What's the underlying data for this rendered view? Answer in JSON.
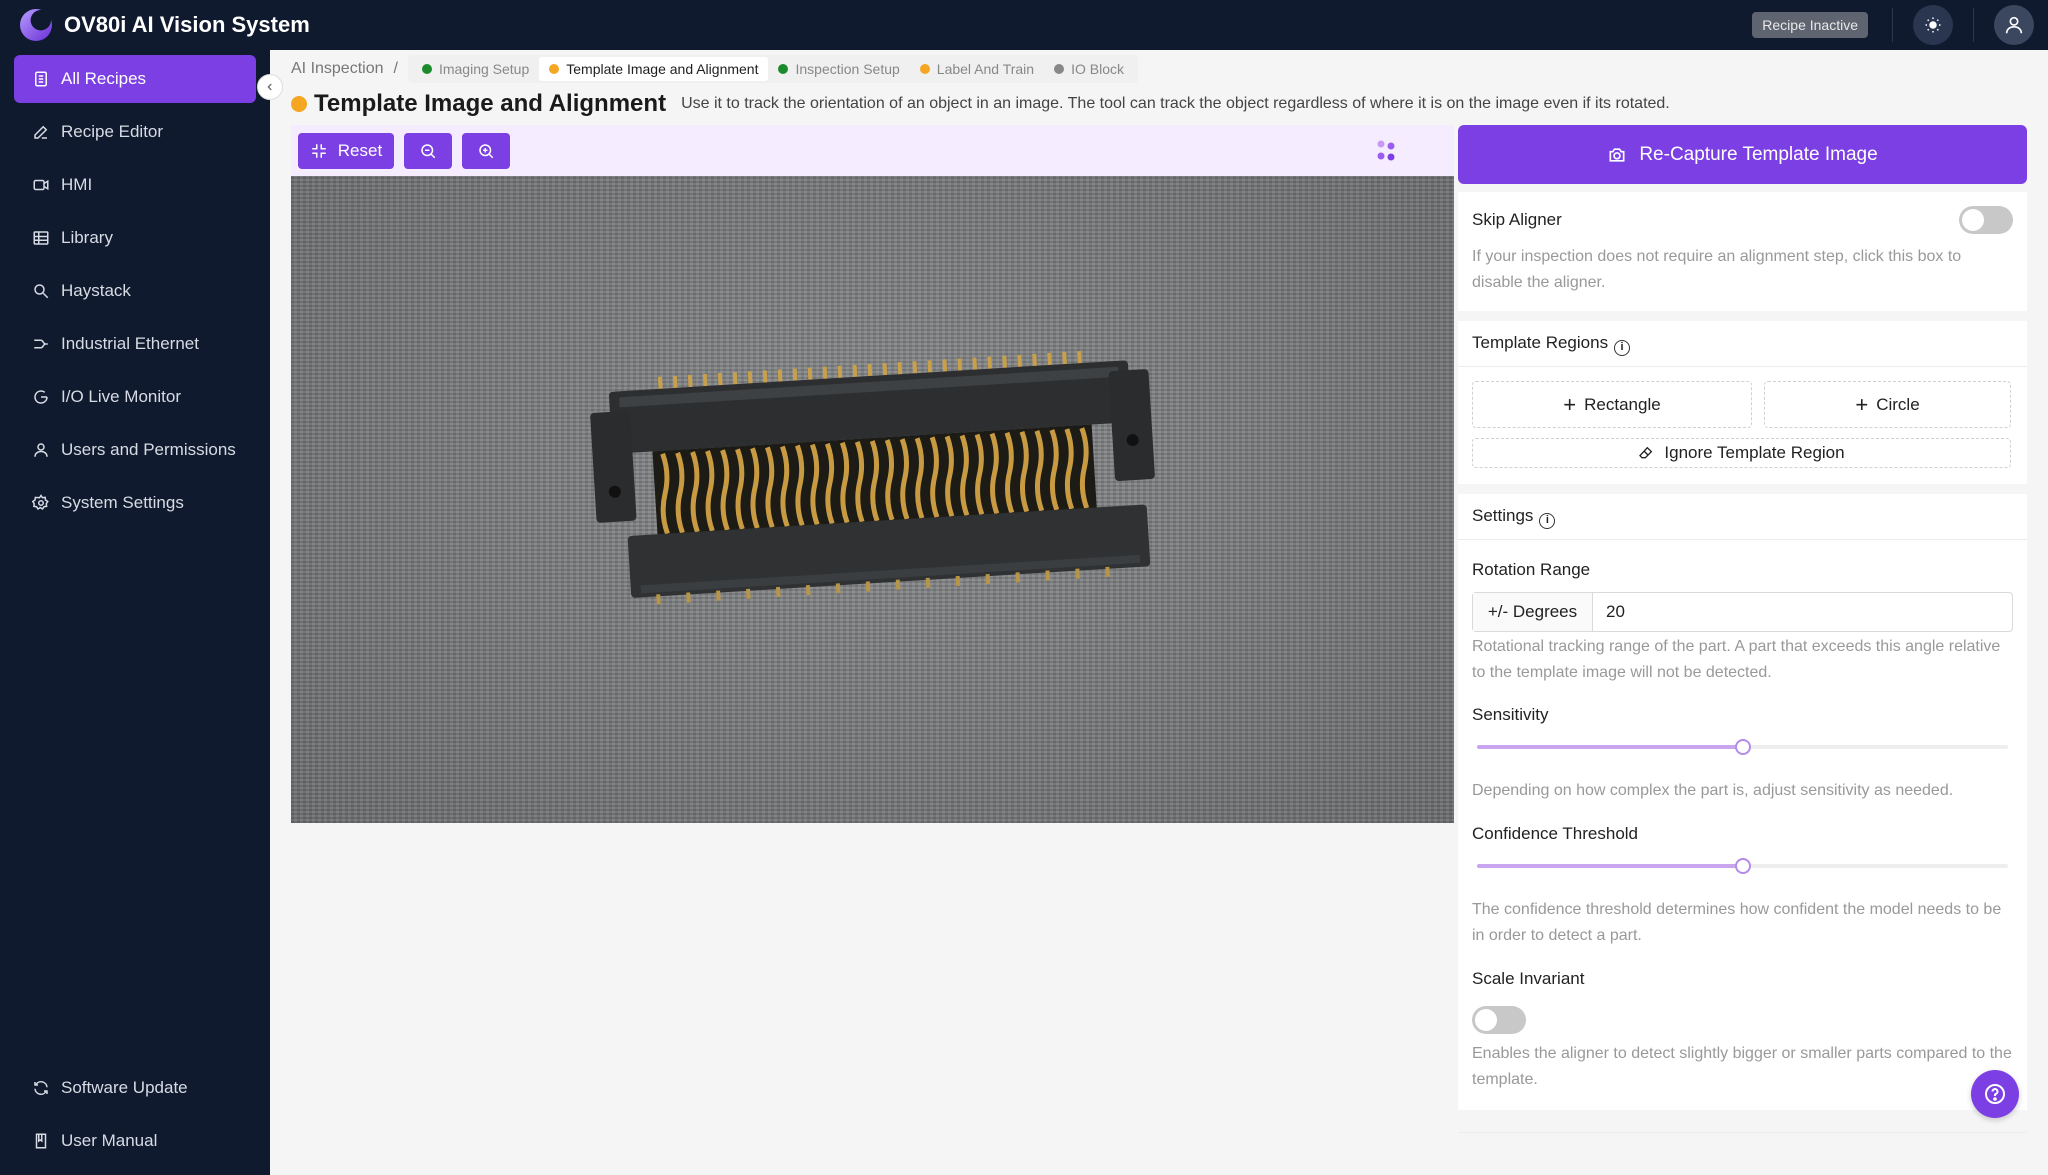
{
  "app": {
    "title": "OV80i AI Vision System",
    "status_badge": "Recipe Inactive"
  },
  "sidebar": {
    "items": [
      {
        "label": "All Recipes",
        "icon": "document-icon",
        "active": true
      },
      {
        "label": "Recipe Editor",
        "icon": "pencil-icon"
      },
      {
        "label": "HMI",
        "icon": "video-icon"
      },
      {
        "label": "Library",
        "icon": "grid-icon"
      },
      {
        "label": "Haystack",
        "icon": "search-icon"
      },
      {
        "label": "Industrial Ethernet",
        "icon": "network-icon"
      },
      {
        "label": "I/O Live Monitor",
        "icon": "monitor-icon"
      },
      {
        "label": "Users and Permissions",
        "icon": "user-icon"
      },
      {
        "label": "System Settings",
        "icon": "gear-icon"
      }
    ],
    "bottom_items": [
      {
        "label": "Software Update",
        "icon": "refresh-icon"
      },
      {
        "label": "User Manual",
        "icon": "book-icon"
      }
    ]
  },
  "breadcrumb": {
    "root": "AI Inspection",
    "separator": "/",
    "steps": [
      {
        "label": "Imaging Setup",
        "color": "#1a8a2a"
      },
      {
        "label": "Template Image and Alignment",
        "color": "#f5a623",
        "active": true
      },
      {
        "label": "Inspection Setup",
        "color": "#1a8a2a"
      },
      {
        "label": "Label And Train",
        "color": "#f5a623"
      },
      {
        "label": "IO Block",
        "color": "#888888"
      }
    ]
  },
  "page": {
    "title": "Template Image and Alignment",
    "description": "Use it to track the orientation of an object in an image. The tool can track the object regardless of where it is on the image even if its rotated."
  },
  "toolbar": {
    "reset_label": "Reset"
  },
  "panel": {
    "recapture_label": "Re-Capture Template Image",
    "skip_aligner": {
      "label": "Skip Aligner",
      "enabled": false,
      "help": "If your inspection does not require an alignment step, click this box to disable the aligner."
    },
    "template_regions": {
      "label": "Template Regions",
      "rectangle_label": "Rectangle",
      "circle_label": "Circle",
      "ignore_label": "Ignore Template Region"
    },
    "settings": {
      "label": "Settings",
      "rotation": {
        "label": "Rotation Range",
        "addon": "+/- Degrees",
        "value": "20",
        "help": "Rotational tracking range of the part. A part that exceeds this angle relative to the template image will not be detected."
      },
      "sensitivity": {
        "label": "Sensitivity",
        "value_fraction": 0.5,
        "help": "Depending on how complex the part is, adjust sensitivity as needed."
      },
      "confidence": {
        "label": "Confidence Threshold",
        "value_fraction": 0.5,
        "help": "The confidence threshold determines how confident the model needs to be in order to detect a part."
      },
      "scale_invariant": {
        "label": "Scale Invariant",
        "enabled": false,
        "help": "Enables the aligner to detect slightly bigger or smaller parts compared to the template."
      }
    }
  },
  "colors": {
    "accent": "#7b3fe4",
    "nav_bg": "#0f1a2e"
  }
}
